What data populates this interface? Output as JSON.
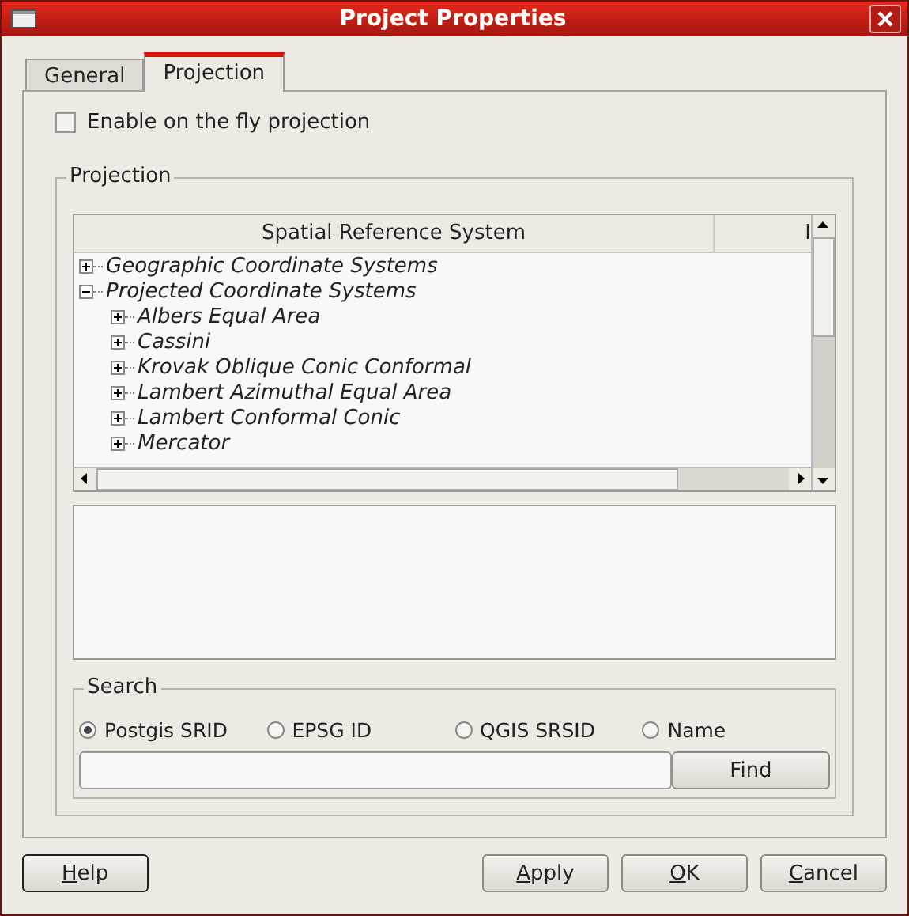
{
  "window": {
    "title": "Project Properties"
  },
  "tabs": [
    {
      "label": "General",
      "selected": false
    },
    {
      "label": "Projection",
      "selected": true
    }
  ],
  "enable_checkbox": {
    "label": "Enable on the fly projection",
    "checked": false
  },
  "projection_group": {
    "title": "Projection",
    "tree": {
      "columns": [
        "Spatial Reference System",
        "I"
      ],
      "items": [
        {
          "label": "Geographic Coordinate Systems",
          "expanded": false
        },
        {
          "label": "Projected Coordinate Systems",
          "expanded": true,
          "children": [
            {
              "label": "Albers Equal Area",
              "expanded": false
            },
            {
              "label": "Cassini",
              "expanded": false
            },
            {
              "label": "Krovak Oblique Conic Conformal",
              "expanded": false
            },
            {
              "label": "Lambert Azimuthal Equal Area",
              "expanded": false
            },
            {
              "label": "Lambert Conformal Conic",
              "expanded": false
            },
            {
              "label": "Mercator",
              "expanded": false
            }
          ]
        }
      ]
    }
  },
  "search_group": {
    "title": "Search",
    "options": [
      {
        "label": "Postgis SRID",
        "selected": true
      },
      {
        "label": "EPSG ID",
        "selected": false
      },
      {
        "label": "QGIS SRSID",
        "selected": false
      },
      {
        "label": "Name",
        "selected": false
      }
    ],
    "find_button": "Find"
  },
  "buttons": [
    {
      "label": "Help",
      "focused": true
    },
    {
      "label": "Apply",
      "focused": false
    },
    {
      "label": "OK",
      "focused": false
    },
    {
      "label": "Cancel",
      "focused": false
    }
  ]
}
